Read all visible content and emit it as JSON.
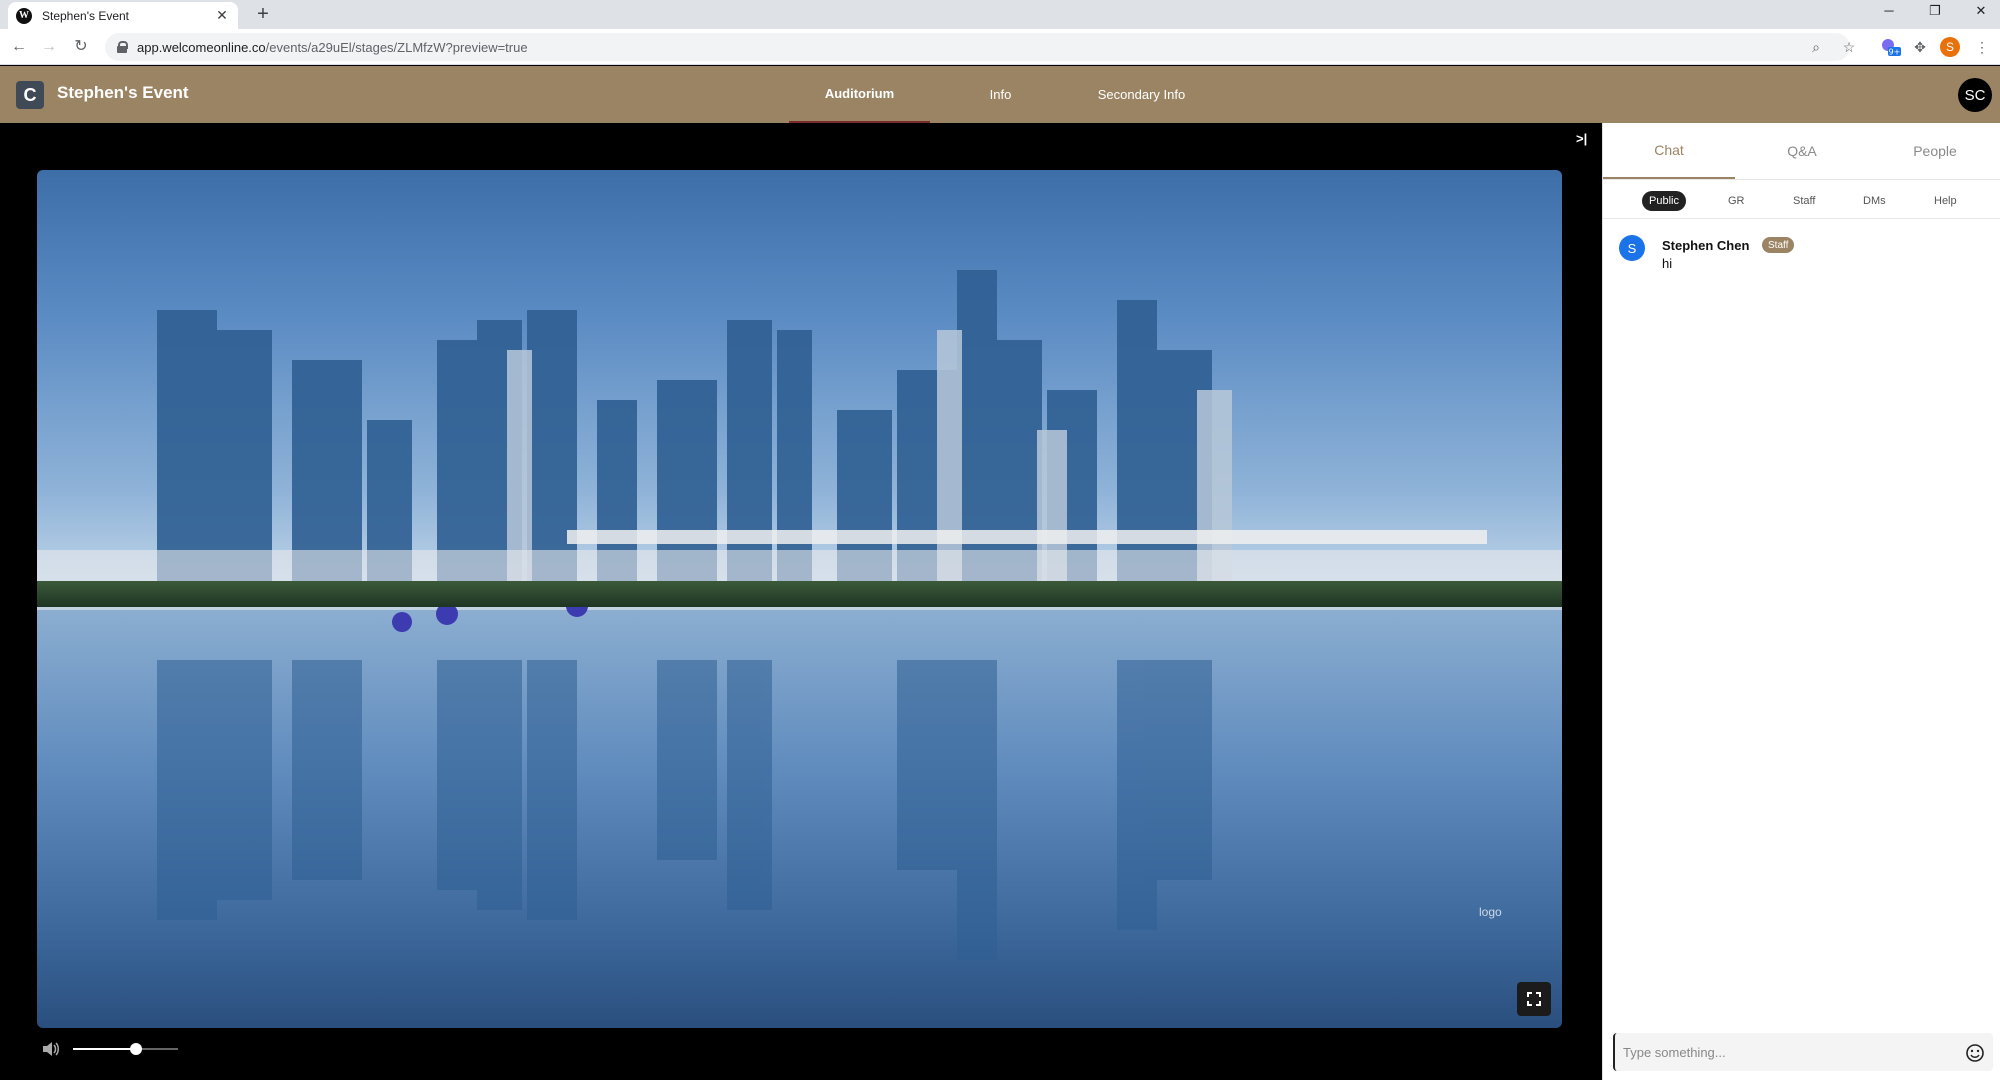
{
  "browser": {
    "tab_title": "Stephen's Event",
    "favicon_letter": "W",
    "url_host": "app.welcomeonline.co",
    "url_path": "/events/a29uEl/stages/ZLMfzW?preview=true",
    "profile_initial": "S",
    "extension_badge": "9+"
  },
  "header": {
    "event_name": "Stephen's Event",
    "nav": [
      "Auditorium",
      "Info",
      "Secondary Info"
    ],
    "active_nav": "Auditorium",
    "user_initials": "SC",
    "brand_color": "#9b8463"
  },
  "stage": {
    "logo_alt": "logo",
    "volume_level": 0.6
  },
  "panel": {
    "tabs": [
      "Chat",
      "Q&A",
      "People"
    ],
    "active_tab": "Chat",
    "subtabs": [
      "Public",
      "GR",
      "Staff",
      "DMs",
      "Help"
    ],
    "active_subtab": "Public",
    "messages": [
      {
        "avatar": "S",
        "author": "Stephen Chen",
        "badge": "Staff",
        "text": "hi"
      }
    ],
    "input_placeholder": "Type something..."
  },
  "icons": [
    "close-icon",
    "plus-icon",
    "back-icon",
    "forward-icon",
    "reload-icon",
    "lock-icon",
    "zoom-icon",
    "star-icon",
    "puzzle-icon",
    "menu-icon",
    "collapse-icon",
    "fullscreen-icon",
    "volume-icon",
    "emoji-icon"
  ]
}
